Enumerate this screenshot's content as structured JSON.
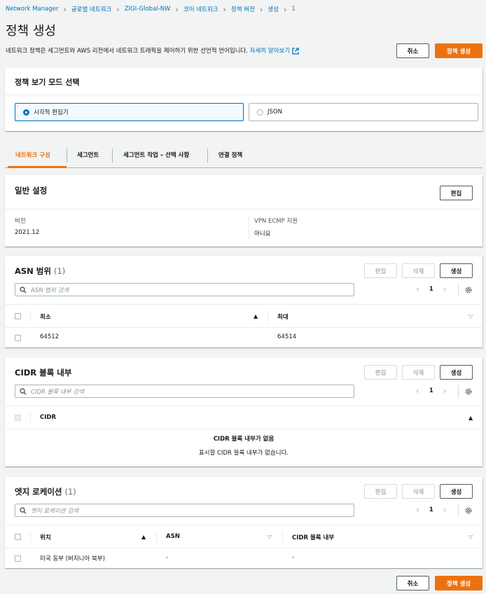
{
  "breadcrumb": [
    {
      "label": "Network Manager"
    },
    {
      "label": "글로벌 네트워크"
    },
    {
      "label": "ZIGI-Global-NW"
    },
    {
      "label": "코어 네트워크"
    },
    {
      "label": "정책 버전"
    },
    {
      "label": "생성"
    },
    {
      "label": "1"
    }
  ],
  "page": {
    "title": "정책 생성",
    "description": "네트워크 정책은 세그먼트와 AWS 리전에서 네트워크 트래픽을 제어하기 위한 선언적 언어입니다.",
    "learn_more": "자세히 알아보기",
    "cancel_label": "취소",
    "create_label": "정책 생성"
  },
  "mode": {
    "title": "정책 보기 모드 선택",
    "options": [
      {
        "label": "시각적 편집기",
        "selected": true
      },
      {
        "label": "JSON",
        "selected": false
      }
    ]
  },
  "tabs": [
    {
      "label": "네트워크 구성",
      "active": true
    },
    {
      "label": "세그먼트",
      "active": false
    },
    {
      "label": "세그먼트 작업 – 선택 사항",
      "active": false
    },
    {
      "label": "연결 정책",
      "active": false
    }
  ],
  "general": {
    "title": "일반 설정",
    "edit_label": "편집",
    "version_label": "버전",
    "version_value": "2021.12",
    "vpn_label": "VPN ECMP 지원",
    "vpn_value": "아니요"
  },
  "asn": {
    "title": "ASN 범위",
    "count": "(1)",
    "edit_label": "편집",
    "delete_label": "삭제",
    "create_label": "생성",
    "search_placeholder": "ASN 범위 검색",
    "page": "1",
    "columns": [
      "최소",
      "최대"
    ],
    "rows": [
      {
        "min": "64512",
        "max": "64514"
      }
    ]
  },
  "cidr": {
    "title": "CIDR 블록 내부",
    "edit_label": "편집",
    "delete_label": "삭제",
    "create_label": "생성",
    "search_placeholder": "CIDR 블록 내부 검색",
    "page": "1",
    "columns": [
      "CIDR"
    ],
    "empty_title": "CIDR 블록 내부가 없음",
    "empty_desc": "표시할 CIDR 블록 내부가 없습니다."
  },
  "edge": {
    "title": "엣지 로케이션",
    "count": "(1)",
    "edit_label": "편집",
    "delete_label": "삭제",
    "create_label": "생성",
    "search_placeholder": "엣지 로케이션 검색",
    "page": "1",
    "columns": [
      "위치",
      "ASN",
      "CIDR 블록 내부"
    ],
    "rows": [
      {
        "location": "미국 동부 (버지니아 북부)",
        "asn": "-",
        "cidr": "-"
      }
    ]
  },
  "colors": {
    "accent": "#ec7211",
    "link": "#0073bb",
    "background": "#f2f3f3"
  }
}
